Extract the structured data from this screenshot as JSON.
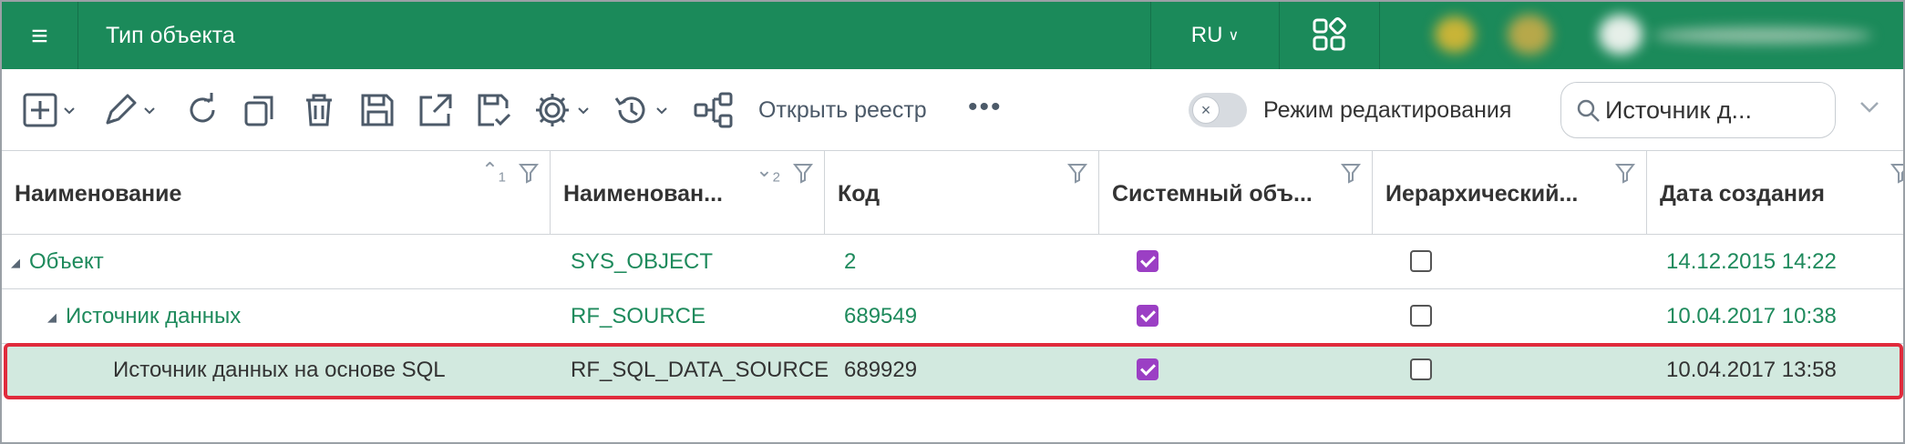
{
  "header": {
    "title": "Тип объекта",
    "menu_icon": "hamburger-icon",
    "language": "RU",
    "apps_icon": "apps-grid-icon",
    "accent": "#1b8a5a"
  },
  "toolbar": {
    "icons": [
      "add-icon",
      "edit-icon",
      "refresh-icon",
      "copy-icon",
      "delete-icon",
      "save-icon",
      "open-external-icon",
      "save-checked-icon",
      "settings-icon",
      "history-icon",
      "tree-structure-icon"
    ],
    "open_registry_label": "Открыть реестр",
    "more_label": "•••",
    "edit_mode_label": "Режим редактирования",
    "search_value": "Источник д..."
  },
  "grid": {
    "columns": [
      {
        "label": "Наименование",
        "sort": "asc",
        "sort_order": "1"
      },
      {
        "label": "Наименован...",
        "sort": "desc",
        "sort_order": "2"
      },
      {
        "label": "Код"
      },
      {
        "label": "Системный объ..."
      },
      {
        "label": "Иерархический..."
      },
      {
        "label": "Дата создания"
      }
    ],
    "rows": [
      {
        "name": "Объект",
        "system_name": "SYS_OBJECT",
        "code": "2",
        "system": true,
        "hierarchical": false,
        "created": "14.12.2015 14:22",
        "level": 0,
        "expanded": true
      },
      {
        "name": "Источник данных",
        "system_name": "RF_SOURCE",
        "code": "689549",
        "system": true,
        "hierarchical": false,
        "created": "10.04.2017 10:38",
        "level": 1,
        "expanded": true
      },
      {
        "name": "Источник данных на основе SQL",
        "system_name": "RF_SQL_DATA_SOURCE",
        "code": "689929",
        "system": true,
        "hierarchical": false,
        "created": "10.04.2017 13:58",
        "level": 2,
        "selected": true
      }
    ],
    "link_color": "#1e8a5c",
    "selected_bg": "#d2e9df",
    "highlight_border": "#e02b3c",
    "checkbox_color": "#9b3fc4"
  }
}
